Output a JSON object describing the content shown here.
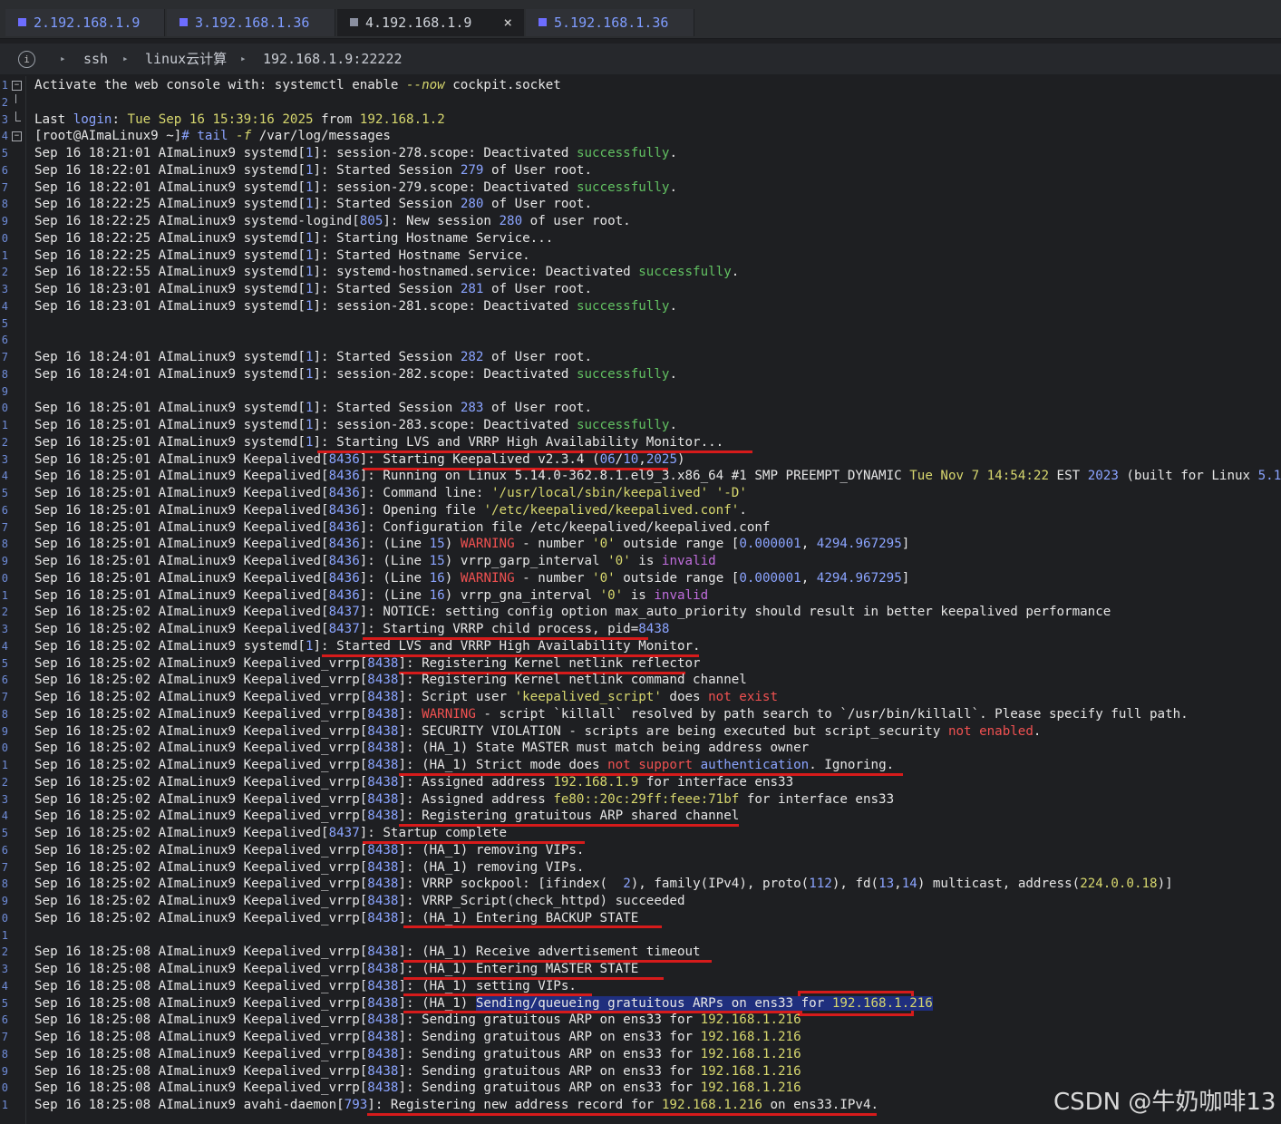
{
  "tabs": [
    {
      "label": "2.192.168.1.9",
      "active": false
    },
    {
      "label": "3.192.168.1.36",
      "active": false
    },
    {
      "label": "4.192.168.1.9",
      "active": true
    },
    {
      "label": "5.192.168.1.36",
      "active": false
    }
  ],
  "close_glyph": "×",
  "breadcrumb": {
    "c1": "ssh",
    "c2": "linux云计算",
    "c3": "192.168.1.9:22222"
  },
  "line_numbers": [
    "1",
    "2",
    "3",
    "4",
    "5",
    "6",
    "7",
    "8",
    "9",
    "0",
    "1",
    "2",
    "3",
    "4",
    "5",
    "6",
    "7",
    "8",
    "9",
    "0",
    "1",
    "2",
    "3",
    "4",
    "5",
    "6",
    "7",
    "8",
    "9",
    "0",
    "1",
    "2",
    "3",
    "4",
    "5",
    "6",
    "7",
    "8",
    "9",
    "0",
    "1",
    "2",
    "3",
    "4",
    "5",
    "6",
    "7",
    "8",
    "9",
    "0",
    "1",
    "2",
    "3",
    "4",
    "5",
    "6",
    "7",
    "8",
    "9",
    "0",
    "1"
  ],
  "watermark": "CSDN @牛奶咖啡13",
  "colors": {
    "green": "#62c162",
    "blue": "#8ba4ff",
    "yellow": "#d7d76e",
    "red": "#f05151",
    "purple": "#c06ddd",
    "underline": "#d61b1b"
  }
}
